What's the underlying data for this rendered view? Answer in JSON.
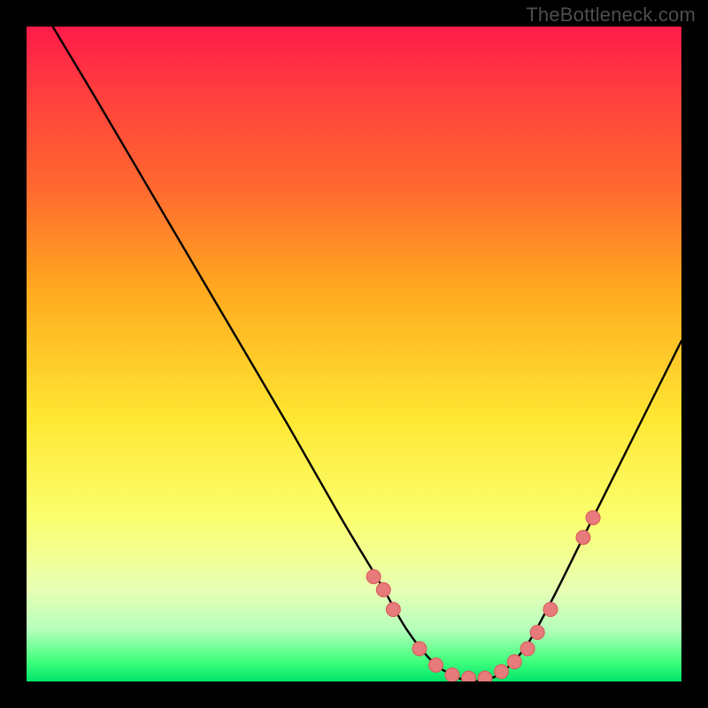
{
  "brand": "TheBottleneck.com",
  "chart_data": {
    "type": "line",
    "title": "",
    "xlabel": "",
    "ylabel": "",
    "xlim": [
      0,
      100
    ],
    "ylim": [
      0,
      100
    ],
    "series": [
      {
        "name": "bottleneck-curve",
        "x": [
          4,
          10,
          20,
          30,
          40,
          48,
          54,
          58,
          62,
          65,
          68,
          72,
          76,
          80,
          85,
          90,
          96,
          100
        ],
        "y": [
          100,
          90,
          73,
          56,
          39,
          25,
          15,
          8,
          3,
          1,
          0,
          1,
          5,
          12,
          22,
          32,
          44,
          52
        ]
      }
    ],
    "markers": {
      "name": "highlight-points",
      "x": [
        53,
        54.5,
        56,
        60,
        62.5,
        65,
        67.5,
        70,
        72.5,
        74.5,
        76.5,
        78,
        80,
        85,
        86.5
      ],
      "y": [
        16,
        14,
        11,
        5,
        2.5,
        1,
        0.5,
        0.5,
        1.5,
        3,
        5,
        7.5,
        11,
        22,
        25
      ]
    },
    "colors": {
      "curve": "#000000",
      "marker_fill": "#e77a7a",
      "marker_stroke": "#d85a5a"
    }
  }
}
